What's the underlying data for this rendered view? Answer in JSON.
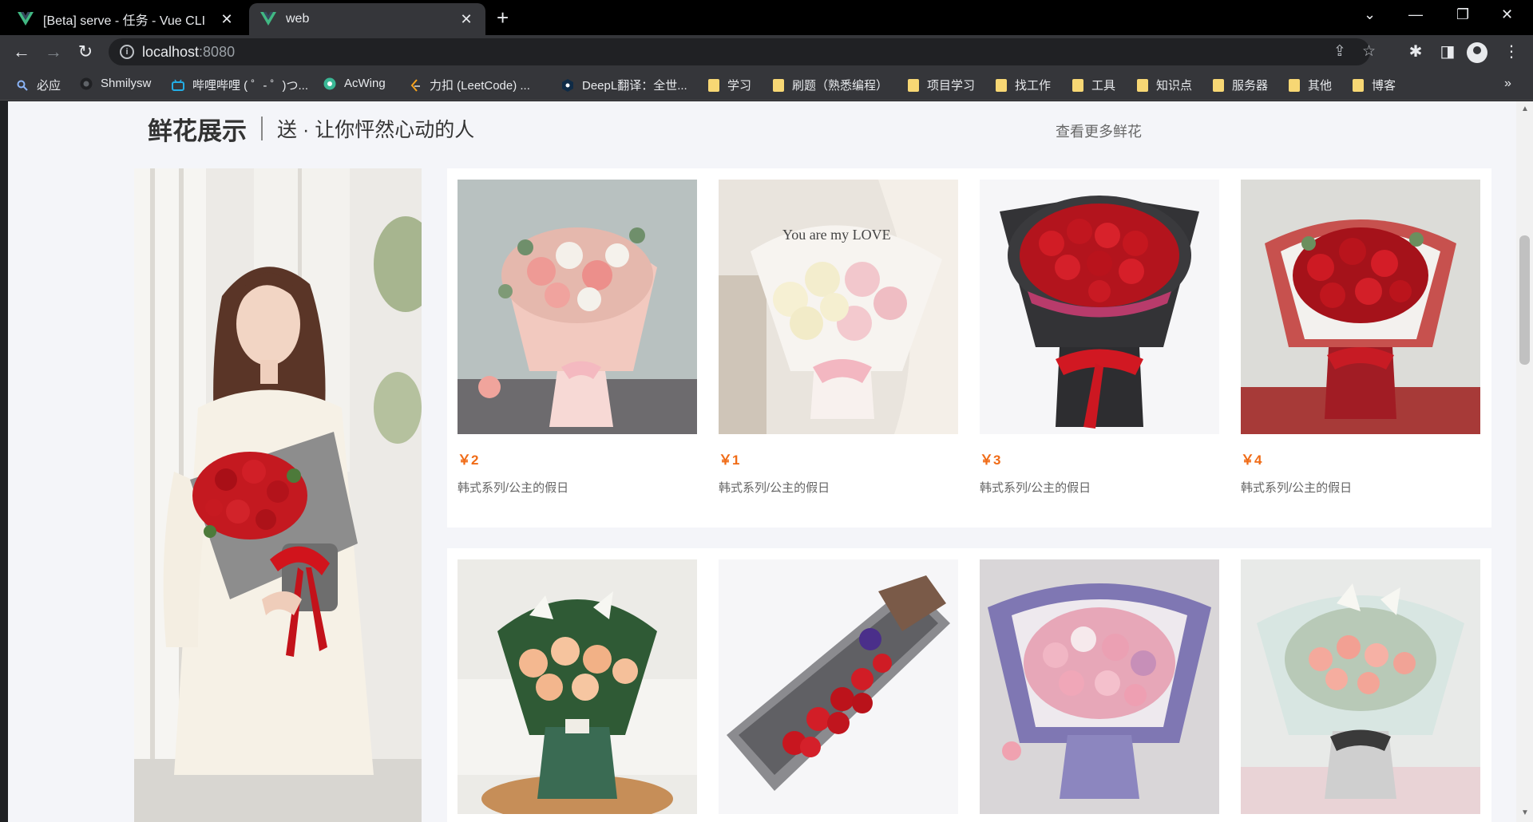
{
  "browser": {
    "tabs": [
      {
        "title": "[Beta] serve - 任务 - Vue CLI",
        "active": false
      },
      {
        "title": "web",
        "active": true
      }
    ],
    "url_host": "localhost",
    "url_port": ":8080",
    "bookmarks": [
      {
        "label": "必应",
        "icon": "bing-search-icon"
      },
      {
        "label": "Shmilysw",
        "icon": "github-icon"
      },
      {
        "label": "哔哩哔哩 ( ゜- ゜)つ...",
        "icon": "bilibili-icon"
      },
      {
        "label": "AcWing",
        "icon": "acwing-icon"
      },
      {
        "label": "力扣 (LeetCode) ...",
        "icon": "leetcode-icon"
      },
      {
        "label": "DeepL翻译：全世...",
        "icon": "deepl-icon"
      },
      {
        "label": "学习",
        "icon": "folder-icon"
      },
      {
        "label": "刷题（熟悉编程）",
        "icon": "folder-icon"
      },
      {
        "label": "项目学习",
        "icon": "folder-icon"
      },
      {
        "label": "找工作",
        "icon": "folder-icon"
      },
      {
        "label": "工具",
        "icon": "folder-icon"
      },
      {
        "label": "知识点",
        "icon": "folder-icon"
      },
      {
        "label": "服务器",
        "icon": "folder-icon"
      },
      {
        "label": "其他",
        "icon": "folder-icon"
      },
      {
        "label": "博客",
        "icon": "folder-icon"
      }
    ],
    "bookmarks_more": "»"
  },
  "section": {
    "title": "鲜花展示",
    "subtitle": "送 · 让你怦然心动的人",
    "view_more": "查看更多鲜花"
  },
  "products": [
    {
      "price": "￥2",
      "name": "韩式系列/公主的假日",
      "image": "pink-rose-bouquet"
    },
    {
      "price": "￥1",
      "name": "韩式系列/公主的假日",
      "image": "white-pink-rose-bouquet"
    },
    {
      "price": "￥3",
      "name": "韩式系列/公主的假日",
      "image": "red-rose-black-wrap"
    },
    {
      "price": "￥4",
      "name": "韩式系列/公主的假日",
      "image": "red-rose-white-wrap"
    },
    {
      "image": "lily-champagne-rose-bouquet"
    },
    {
      "image": "red-rose-gift-box"
    },
    {
      "image": "pink-rose-purple-wrap"
    },
    {
      "image": "lily-pink-rose-bouquet"
    }
  ],
  "colors": {
    "price": "#f06b16",
    "page_bg": "#f4f5f9",
    "chrome_dark": "#35363a"
  }
}
